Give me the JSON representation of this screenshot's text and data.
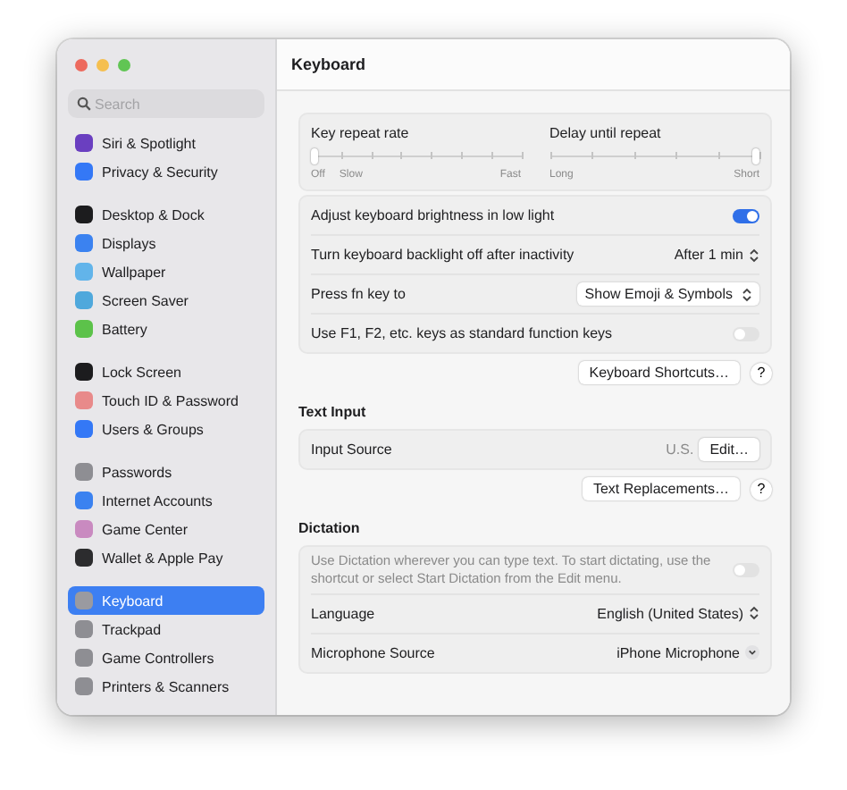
{
  "window": {
    "title": "Keyboard"
  },
  "sidebar": {
    "search": {
      "placeholder": "Search"
    },
    "groups": [
      {
        "items": [
          {
            "label": "Siri & Spotlight",
            "color": "#6a3fc0",
            "selected": false
          },
          {
            "label": "Privacy & Security",
            "color": "#3478f6",
            "selected": false
          }
        ]
      },
      {
        "items": [
          {
            "label": "Desktop & Dock",
            "color": "#1c1c1e",
            "selected": false
          },
          {
            "label": "Displays",
            "color": "#3b82f0",
            "selected": false
          },
          {
            "label": "Wallpaper",
            "color": "#62b4ea",
            "selected": false
          },
          {
            "label": "Screen Saver",
            "color": "#4fa8dc",
            "selected": false
          },
          {
            "label": "Battery",
            "color": "#5cc24a",
            "selected": false
          }
        ]
      },
      {
        "items": [
          {
            "label": "Lock Screen",
            "color": "#1c1c1e",
            "selected": false
          },
          {
            "label": "Touch ID & Password",
            "color": "#e88a8a",
            "selected": false
          },
          {
            "label": "Users & Groups",
            "color": "#3478f6",
            "selected": false
          }
        ]
      },
      {
        "items": [
          {
            "label": "Passwords",
            "color": "#8e8e93",
            "selected": false
          },
          {
            "label": "Internet Accounts",
            "color": "#3b82f0",
            "selected": false
          },
          {
            "label": "Game Center",
            "color": "#c98ac0",
            "selected": false
          },
          {
            "label": "Wallet & Apple Pay",
            "color": "#2c2c2e",
            "selected": false
          }
        ]
      },
      {
        "items": [
          {
            "label": "Keyboard",
            "color": "#9a9aa0",
            "selected": true
          },
          {
            "label": "Trackpad",
            "color": "#8e8e93",
            "selected": false
          },
          {
            "label": "Game Controllers",
            "color": "#8e8e93",
            "selected": false
          },
          {
            "label": "Printers & Scanners",
            "color": "#8e8e93",
            "selected": false
          }
        ]
      }
    ]
  },
  "blocks": [
    {
      "kind": "sliders",
      "sliders": [
        {
          "label": "Key repeat rate",
          "level": 0,
          "marks": [
            "Off",
            "Slow",
            "Fast"
          ]
        },
        {
          "label": "Delay until repeat",
          "level": 1,
          "marks": [
            "Long",
            "Short"
          ]
        }
      ]
    },
    {
      "kind": "rows",
      "rows": [
        {
          "kind": "toggle",
          "label": "Adjust keyboard brightness in low light",
          "on": true
        },
        {
          "kind": "stepper",
          "label": "Turn keyboard backlight off after inactivity",
          "value": "After 1 min"
        },
        {
          "kind": "popup",
          "label": "Press fn key to",
          "value": "Show Emoji & Symbols"
        },
        {
          "kind": "toggle",
          "label": "Use F1, F2, etc. keys as standard function keys",
          "on": false
        }
      ]
    },
    {
      "kind": "buttons",
      "button": "Keyboard Shortcuts…",
      "help": "?"
    },
    {
      "kind": "heading",
      "text": "Text Input"
    },
    {
      "kind": "rows",
      "rows": [
        {
          "kind": "edit",
          "label": "Input Source",
          "value": "U.S.",
          "button": "Edit…"
        }
      ]
    },
    {
      "kind": "buttons",
      "button": "Text Replacements…",
      "help": "?"
    },
    {
      "kind": "heading",
      "text": "Dictation"
    },
    {
      "kind": "rows",
      "rows": [
        {
          "kind": "note-toggle",
          "label": "Use Dictation wherever you can type text. To start dictating, use the shortcut or select Start Dictation from the Edit menu.",
          "on": false
        },
        {
          "kind": "stepper",
          "label": "Language",
          "value": "English (United States)"
        },
        {
          "kind": "menu",
          "label": "Microphone Source",
          "value": "iPhone Microphone"
        }
      ]
    }
  ]
}
